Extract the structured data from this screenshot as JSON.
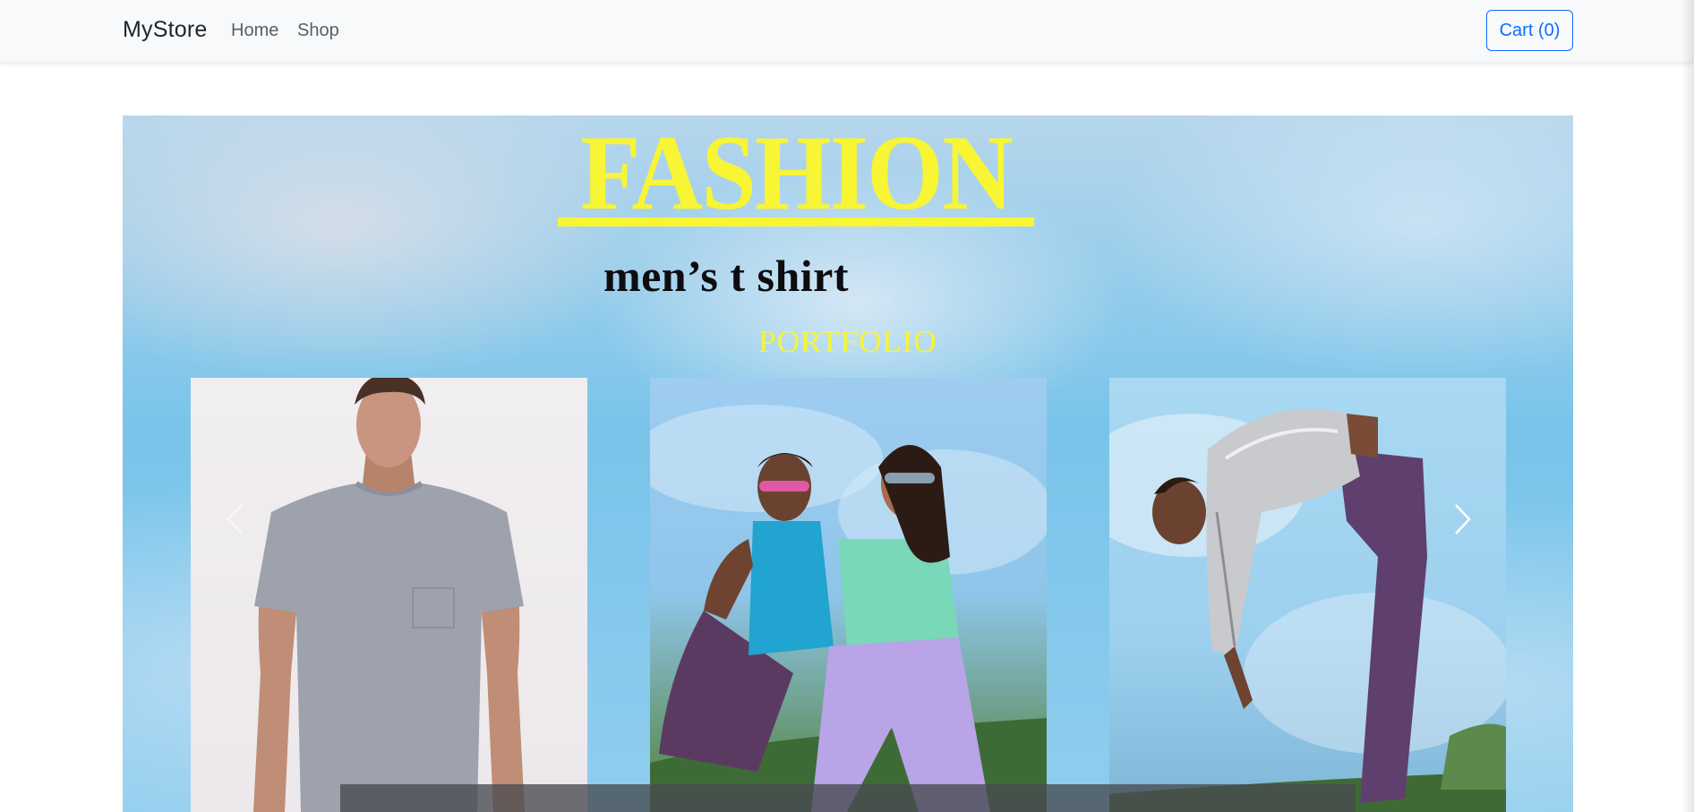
{
  "navbar": {
    "brand": "MyStore",
    "links": [
      "Home",
      "Shop"
    ],
    "cart_label": "Cart (0)"
  },
  "hero": {
    "title": "FASHION",
    "subtitle": "men’s t shirt",
    "tagline": "PORTFOLIO",
    "caption": "..."
  },
  "icons": {
    "prev": "chevron-left-icon",
    "next": "chevron-right-icon"
  },
  "colors": {
    "accent": "#f7f534",
    "brand_blue": "#0d6efd",
    "sky": "#79c4ea"
  }
}
